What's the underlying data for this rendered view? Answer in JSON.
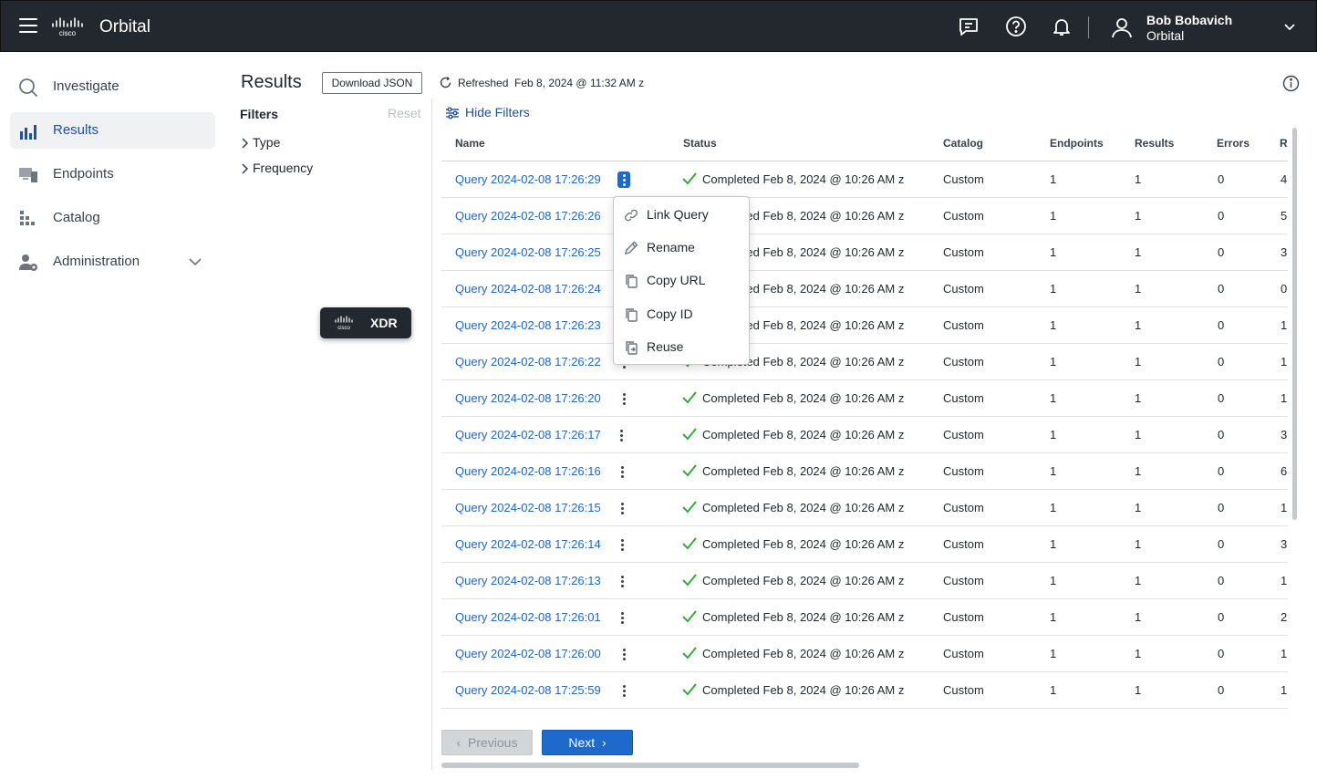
{
  "header": {
    "app_name": "Orbital",
    "user_name": "Bob Bobavich",
    "user_org": "Orbital"
  },
  "sidebar": {
    "items": [
      {
        "label": "Investigate",
        "icon": "search-icon"
      },
      {
        "label": "Results",
        "icon": "bar-chart-icon",
        "active": true
      },
      {
        "label": "Endpoints",
        "icon": "endpoints-icon"
      },
      {
        "label": "Catalog",
        "icon": "catalog-icon"
      },
      {
        "label": "Administration",
        "icon": "admin-icon"
      }
    ]
  },
  "xdr_badge": {
    "label": "XDR"
  },
  "filters": {
    "page_title": "Results",
    "download_label": "Download JSON",
    "title": "Filters",
    "reset_label": "Reset",
    "groups": [
      "Type",
      "Frequency"
    ]
  },
  "main": {
    "refreshed_text": "Refreshed",
    "refreshed_time": "Feb 8, 2024 @ 11:32 AM z",
    "hide_filters_label": "Hide Filters"
  },
  "table": {
    "columns": [
      "Name",
      "Status",
      "Catalog",
      "Endpoints",
      "Results",
      "Errors",
      "R"
    ],
    "rows": [
      {
        "name": "Query 2024-02-08 17:26:29",
        "status": "Completed",
        "time": "Feb 8, 2024 @ 10:26 AM z",
        "catalog": "Custom",
        "endpoints": "1",
        "results": "1",
        "errors": "0",
        "extra": "4"
      },
      {
        "name": "Query 2024-02-08 17:26:26",
        "status": "Completed",
        "time": "Feb 8, 2024 @ 10:26 AM z",
        "catalog": "Custom",
        "endpoints": "1",
        "results": "1",
        "errors": "0",
        "extra": "5"
      },
      {
        "name": "Query 2024-02-08 17:26:25",
        "status": "Completed",
        "time": "Feb 8, 2024 @ 10:26 AM z",
        "catalog": "Custom",
        "endpoints": "1",
        "results": "1",
        "errors": "0",
        "extra": "3"
      },
      {
        "name": "Query 2024-02-08 17:26:24",
        "status": "Completed",
        "time": "Feb 8, 2024 @ 10:26 AM z",
        "catalog": "Custom",
        "endpoints": "1",
        "results": "1",
        "errors": "0",
        "extra": "0"
      },
      {
        "name": "Query 2024-02-08 17:26:23",
        "status": "Completed",
        "time": "Feb 8, 2024 @ 10:26 AM z",
        "catalog": "Custom",
        "endpoints": "1",
        "results": "1",
        "errors": "0",
        "extra": "1"
      },
      {
        "name": "Query 2024-02-08 17:26:22",
        "status": "Completed",
        "time": "Feb 8, 2024 @ 10:26 AM z",
        "catalog": "Custom",
        "endpoints": "1",
        "results": "1",
        "errors": "0",
        "extra": "1"
      },
      {
        "name": "Query 2024-02-08 17:26:20",
        "status": "Completed",
        "time": "Feb 8, 2024 @ 10:26 AM z",
        "catalog": "Custom",
        "endpoints": "1",
        "results": "1",
        "errors": "0",
        "extra": "1"
      },
      {
        "name": "Query 2024-02-08 17:26:17",
        "status": "Completed",
        "time": "Feb 8, 2024 @ 10:26 AM z",
        "catalog": "Custom",
        "endpoints": "1",
        "results": "1",
        "errors": "0",
        "extra": "3"
      },
      {
        "name": "Query 2024-02-08 17:26:16",
        "status": "Completed",
        "time": "Feb 8, 2024 @ 10:26 AM z",
        "catalog": "Custom",
        "endpoints": "1",
        "results": "1",
        "errors": "0",
        "extra": "6"
      },
      {
        "name": "Query 2024-02-08 17:26:15",
        "status": "Completed",
        "time": "Feb 8, 2024 @ 10:26 AM z",
        "catalog": "Custom",
        "endpoints": "1",
        "results": "1",
        "errors": "0",
        "extra": "1"
      },
      {
        "name": "Query 2024-02-08 17:26:14",
        "status": "Completed",
        "time": "Feb 8, 2024 @ 10:26 AM z",
        "catalog": "Custom",
        "endpoints": "1",
        "results": "1",
        "errors": "0",
        "extra": "3"
      },
      {
        "name": "Query 2024-02-08 17:26:13",
        "status": "Completed",
        "time": "Feb 8, 2024 @ 10:26 AM z",
        "catalog": "Custom",
        "endpoints": "1",
        "results": "1",
        "errors": "0",
        "extra": "1"
      },
      {
        "name": "Query 2024-02-08 17:26:01",
        "status": "Completed",
        "time": "Feb 8, 2024 @ 10:26 AM z",
        "catalog": "Custom",
        "endpoints": "1",
        "results": "1",
        "errors": "0",
        "extra": "2"
      },
      {
        "name": "Query 2024-02-08 17:26:00",
        "status": "Completed",
        "time": "Feb 8, 2024 @ 10:26 AM z",
        "catalog": "Custom",
        "endpoints": "1",
        "results": "1",
        "errors": "0",
        "extra": "1"
      },
      {
        "name": "Query 2024-02-08 17:25:59",
        "status": "Completed",
        "time": "Feb 8, 2024 @ 10:26 AM z",
        "catalog": "Custom",
        "endpoints": "1",
        "results": "1",
        "errors": "0",
        "extra": "1"
      }
    ]
  },
  "context_menu": {
    "items": [
      {
        "label": "Link Query",
        "icon": "link-icon"
      },
      {
        "label": "Rename",
        "icon": "pencil-icon"
      },
      {
        "label": "Copy URL",
        "icon": "copy-icon"
      },
      {
        "label": "Copy ID",
        "icon": "copy-icon"
      },
      {
        "label": "Reuse",
        "icon": "reuse-icon"
      }
    ]
  },
  "pagination": {
    "previous_label": "Previous",
    "next_label": "Next"
  },
  "colors": {
    "topbar": "#23282e",
    "link": "#1e66c8",
    "primary_button": "#1d69cc",
    "success": "#3aa83f"
  }
}
